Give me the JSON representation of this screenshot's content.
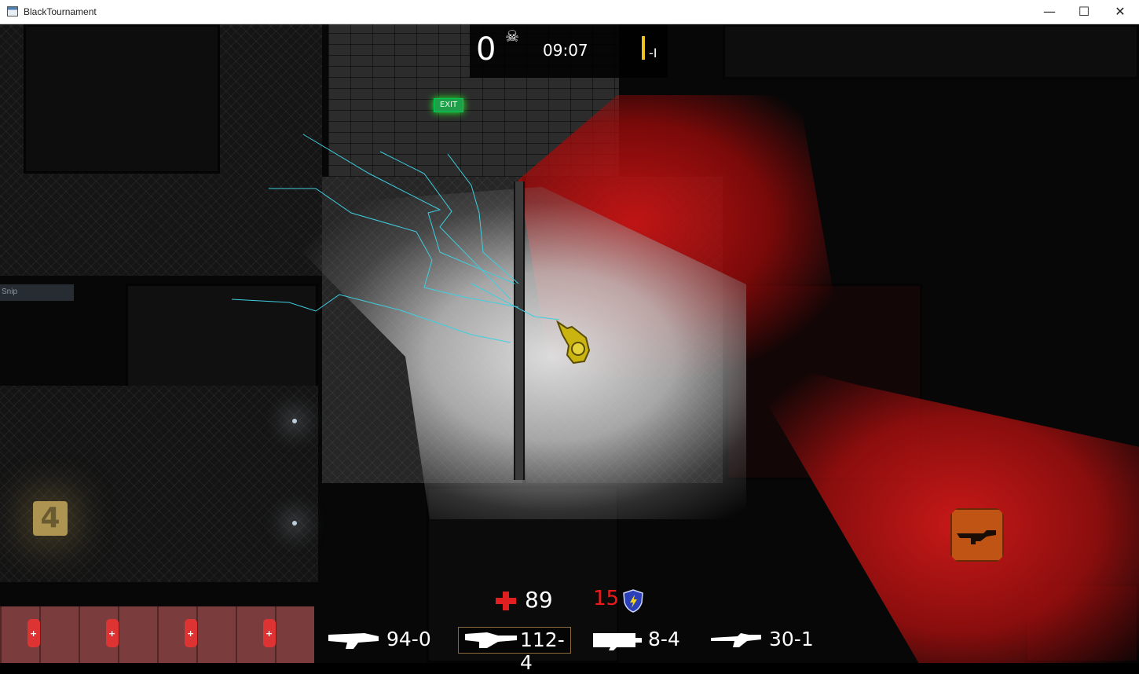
{
  "window": {
    "title": "BlackTournament",
    "controls": {
      "minimize": "—",
      "maximize": "☐",
      "close": "✕"
    }
  },
  "hud": {
    "kills": "0",
    "timer": "09:07",
    "rank": "-I",
    "health": "89",
    "armor": "15",
    "colors": {
      "armor": "#ee1a1a",
      "rank_bar": "#f0c020",
      "health_cross": "#e02020"
    }
  },
  "weapons": [
    {
      "name": "weapon-1",
      "ammo": "94-0",
      "selected": false
    },
    {
      "name": "weapon-2",
      "ammo": "112-4",
      "selected": true
    },
    {
      "name": "weapon-3",
      "ammo": "8-4",
      "selected": false
    },
    {
      "name": "weapon-4",
      "ammo": "30-1",
      "selected": false
    }
  ],
  "scene": {
    "exit_sign": "EXIT",
    "pad_label": "4",
    "snip_overlay": "Snip",
    "icons": [
      "skull-icon",
      "health-cross-icon",
      "armor-shield-icon",
      "rifle-pickup-icon",
      "player-character",
      "exit-sign"
    ]
  }
}
